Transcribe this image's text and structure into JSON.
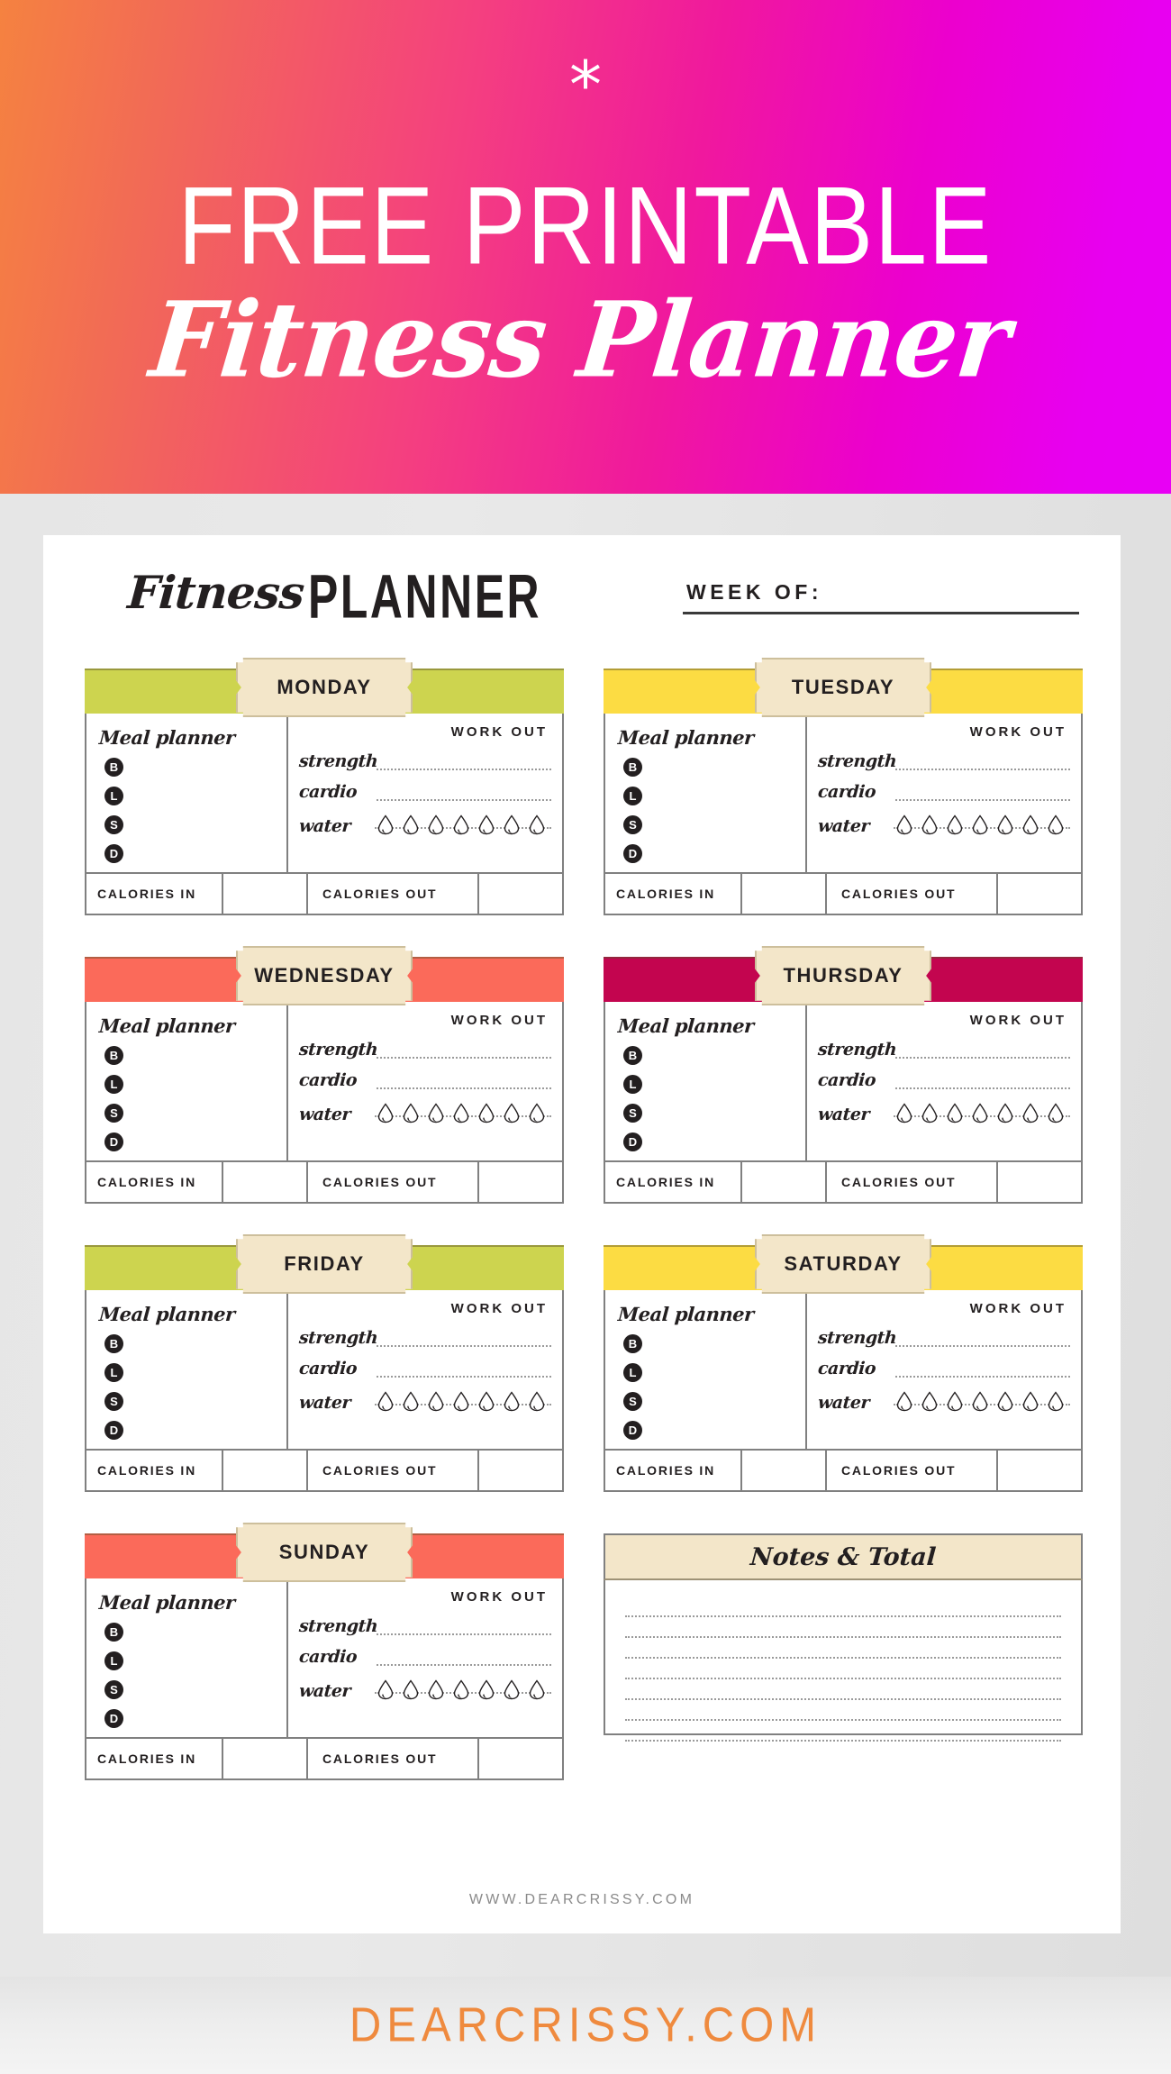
{
  "banner": {
    "asterisk": "*",
    "line1": "FREE PRINTABLE",
    "line2": "Fitness Planner",
    "gradient_from": "#f58240",
    "gradient_to": "#e800f5"
  },
  "planner": {
    "title_script": "Fitness",
    "title_block": "PLANNER",
    "week_of_label": "WEEK OF:",
    "week_of_value": "",
    "footer_url": "WWW.DEARCRISSY.COM"
  },
  "labels": {
    "meal_planner": "Meal planner",
    "work_out": "WORK OUT",
    "strength": "strength",
    "cardio": "cardio",
    "water": "water",
    "calories_in": "CALORIES IN",
    "calories_out": "CALORIES OUT",
    "calories_in_value": "",
    "calories_out_value": "",
    "meal_slots": [
      "B",
      "L",
      "S",
      "D"
    ],
    "water_drops": 7
  },
  "days": [
    {
      "name": "MONDAY",
      "color": "#cdd44f"
    },
    {
      "name": "TUESDAY",
      "color": "#fcdc43"
    },
    {
      "name": "WEDNESDAY",
      "color": "#fb6a5a"
    },
    {
      "name": "THURSDAY",
      "color": "#c3054f"
    },
    {
      "name": "FRIDAY",
      "color": "#cdd44f"
    },
    {
      "name": "SATURDAY",
      "color": "#fcdc43"
    },
    {
      "name": "SUNDAY",
      "color": "#fb6a5a"
    }
  ],
  "notes": {
    "title": "Notes & Total",
    "line_count": 7,
    "header_bg": "#f3e6c9"
  },
  "bottom_bar": {
    "brand": "DEARCRISSY.COM",
    "brand_color": "#ef8a3e"
  }
}
